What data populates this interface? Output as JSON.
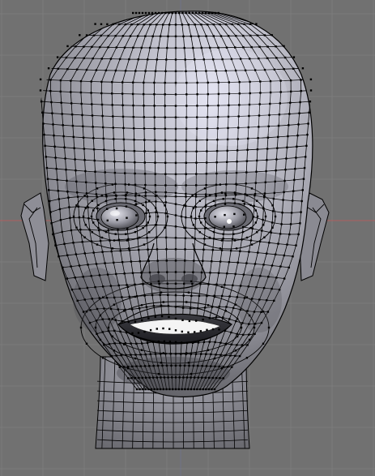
{
  "viewport": {
    "background_color": "#717171",
    "grid_color": "#7c7c7c",
    "x_axis_color": "#b06060",
    "z_axis_color": "#6a78b0",
    "mesh_shade_light": "#dcdcec",
    "mesh_shade_mid": "#a9a9b4",
    "mesh_shade_dark": "#5a5a60",
    "wire_color": "#000000",
    "vertex_color": "#000000",
    "teeth_color": "#f4f4f4"
  },
  "model": {
    "object": "head-mesh",
    "view": "front-orthographic",
    "mode": "edit-mode-wireframe-overlay"
  }
}
